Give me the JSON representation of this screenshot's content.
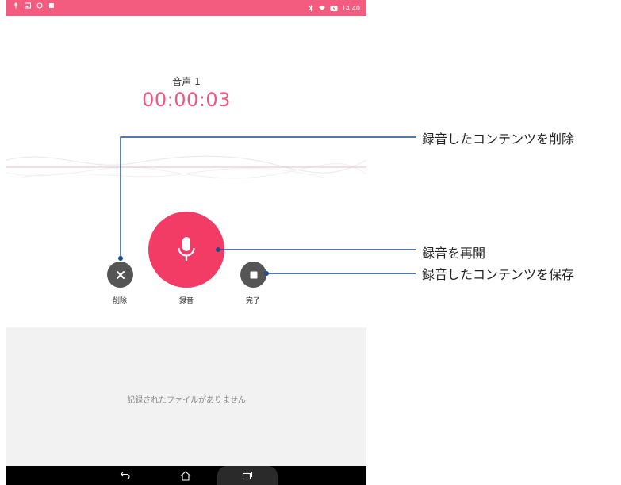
{
  "status_bar": {
    "time": "14:40",
    "color": "#f35b7f"
  },
  "recording": {
    "title": "音声 1",
    "timer": "00:00:03"
  },
  "controls": {
    "delete_label": "削除",
    "record_label": "録音",
    "done_label": "完了"
  },
  "files": {
    "empty_message": "記録されたファイルがありません"
  },
  "annotations": {
    "delete": "録音したコンテンツを削除",
    "resume": "録音を再開",
    "save": "録音したコンテンツを保存"
  },
  "colors": {
    "accent": "#f23c66",
    "timer": "#f0577e",
    "callout_line": "#1a4f8f"
  }
}
